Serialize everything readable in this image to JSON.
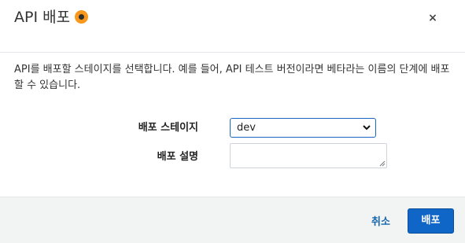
{
  "dialog": {
    "title": "API 배포",
    "close_label": "×",
    "description": "API를 배포할 스테이지를 선택합니다. 예를 들어, API 테스트 버전이라면 베타라는 이름의 단계에 배포할 수 있습니다."
  },
  "form": {
    "stage_label": "배포 스테이지",
    "stage_value": "dev",
    "description_label": "배포 설명",
    "description_value": ""
  },
  "footer": {
    "cancel_label": "취소",
    "deploy_label": "배포"
  },
  "colors": {
    "accent": "#0f66c7",
    "link": "#1665ad",
    "info_icon": "#f8991d",
    "footer_bg": "#f2f3f3"
  }
}
